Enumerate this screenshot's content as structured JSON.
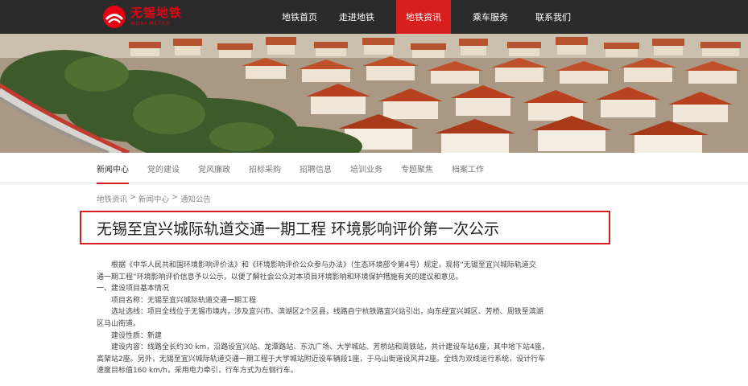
{
  "header": {
    "logo_text": "无锡地铁",
    "logo_en": "WUXI METRO",
    "nav": [
      {
        "label": "地铁首页",
        "active": false
      },
      {
        "label": "走进地铁",
        "active": false
      },
      {
        "label": "地铁资讯",
        "active": true
      },
      {
        "label": "乘车服务",
        "active": false
      },
      {
        "label": "联系我们",
        "active": false
      }
    ]
  },
  "subnav": [
    {
      "label": "新闻中心",
      "active": true
    },
    {
      "label": "党的建设",
      "active": false
    },
    {
      "label": "党风廉政",
      "active": false
    },
    {
      "label": "招标采购",
      "active": false
    },
    {
      "label": "招聘信息",
      "active": false
    },
    {
      "label": "培训业务",
      "active": false
    },
    {
      "label": "专题聚焦",
      "active": false
    },
    {
      "label": "档案工作",
      "active": false
    }
  ],
  "breadcrumb": [
    "地铁资讯",
    "新闻中心",
    "通知公告"
  ],
  "breadcrumb_sep": " > ",
  "article": {
    "title": "无锡至宜兴城际轨道交通一期工程 环境影响评价第一次公示",
    "lines": [
      "根据《中华人民共和国环境影响评价法》和《环境影响评价公众参与办法》（生态环境部令第4号）规定，现将“无锡至宜兴城际轨道交",
      "通一期工程”环境影响评价信息予以公示，以便了解社会公众对本项目环境影响和环境保护措施有关的建议和意见。",
      "一、建设项目基本情况",
      "项目名称：无锡至宜兴城际轨道交通一期工程",
      "选址选线：项目全线位于无锡市境内，涉及宜兴市、滨湖区2个区县，线路自宁杭铁路宜兴站引出，向东经宜兴城区、芳桥、周铁至滨湖",
      "区马山街道。",
      "建设性质：新建",
      "建设内容：线路全长约30 km，沿路设宜兴站、龙潭路站、东氿广场、大学城站、芳桥站和周铁站，共计建设车站6座，其中地下站4座，",
      "高架站2座。另外，无锡至宜兴城际轨道交通一期工程于大学城站附近设车辆段1座，于马山街道设风井2座。全线为双线运行系统，设计行车",
      "速度目标值160 km/h，采用电力牵引，行车方式为左侧行车。"
    ]
  }
}
